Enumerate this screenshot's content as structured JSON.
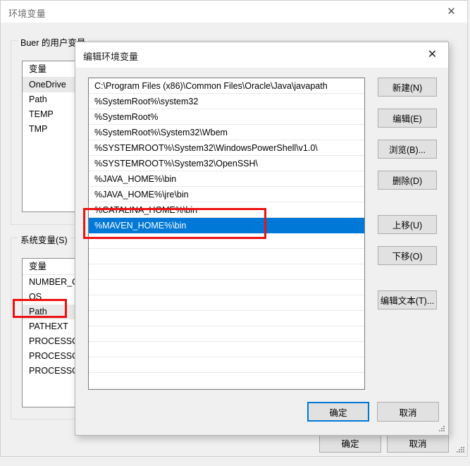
{
  "parent_window": {
    "title": "环境变量",
    "close_icon": "close-icon",
    "user_group": {
      "label": "Buer 的用户变量",
      "column_header": "变量",
      "items": [
        "OneDrive",
        "Path",
        "TEMP",
        "TMP"
      ]
    },
    "system_group": {
      "label": "系统变量(S)",
      "column_header": "变量",
      "items": [
        "NUMBER_OF",
        "OS",
        "Path",
        "PATHEXT",
        "PROCESSOR",
        "PROCESSOR",
        "PROCESSOR"
      ]
    },
    "ok_label": "确定",
    "cancel_label": "取消"
  },
  "modal": {
    "title": "编辑环境变量",
    "close_icon": "close-icon",
    "path_entries": [
      "C:\\Program Files (x86)\\Common Files\\Oracle\\Java\\javapath",
      "%SystemRoot%\\system32",
      "%SystemRoot%",
      "%SystemRoot%\\System32\\Wbem",
      "%SYSTEMROOT%\\System32\\WindowsPowerShell\\v1.0\\",
      "%SYSTEMROOT%\\System32\\OpenSSH\\",
      "%JAVA_HOME%\\bin",
      "%JAVA_HOME%\\jre\\bin",
      "%CATALINA_HOME%\\bin",
      "%MAVEN_HOME%\\bin"
    ],
    "selected_index": 9,
    "empty_row_count": 10,
    "side_buttons": [
      {
        "label": "新建(N)",
        "name": "new-button"
      },
      {
        "label": "编辑(E)",
        "name": "edit-button"
      },
      {
        "label": "浏览(B)...",
        "name": "browse-button"
      },
      {
        "label": "删除(D)",
        "name": "delete-button"
      },
      {
        "label": "上移(U)",
        "name": "move-up-button"
      },
      {
        "label": "下移(O)",
        "name": "move-down-button"
      },
      {
        "label": "编辑文本(T)...",
        "name": "edit-text-button"
      }
    ],
    "ok_label": "确定",
    "cancel_label": "取消"
  },
  "annotations": {
    "highlight_color": "#ee1111",
    "selection_color": "#0078d7",
    "boxes": [
      {
        "name": "maven-home-highlight",
        "target": "%MAVEN_HOME%\\bin"
      },
      {
        "name": "system-path-highlight",
        "target": "Path"
      }
    ]
  }
}
